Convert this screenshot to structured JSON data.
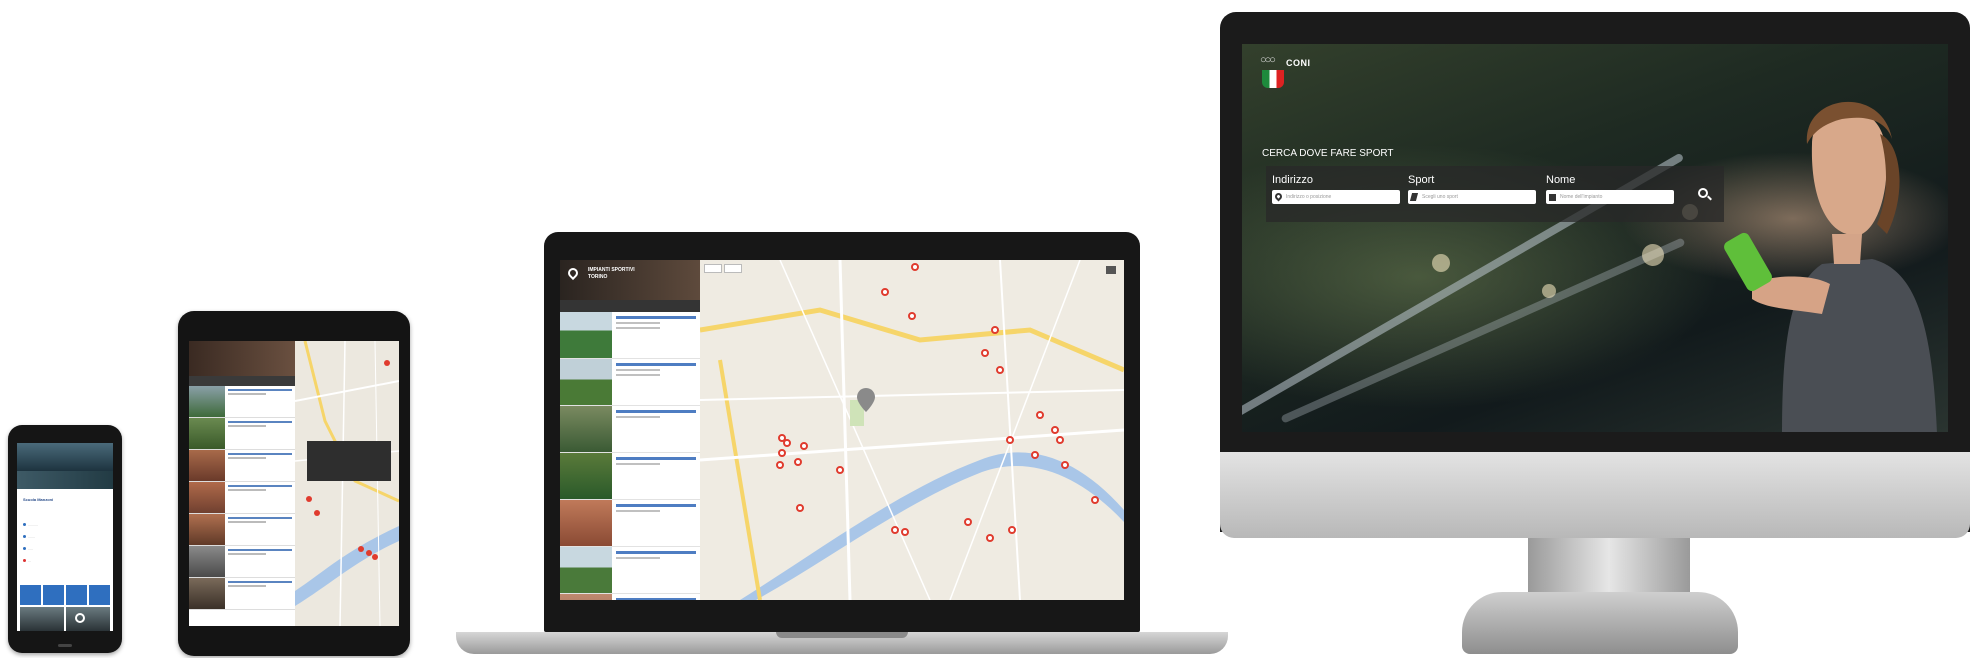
{
  "desktop": {
    "brand": {
      "name": "CONI",
      "rings_icon": "olympic-rings-icon",
      "flag_icon": "italy-flag-shield-icon"
    },
    "search": {
      "heading": "CERCA DOVE FARE SPORT",
      "fields": [
        {
          "label": "Indirizzo",
          "placeholder": "Indirizzo o posizione",
          "icon": "map-pin-icon"
        },
        {
          "label": "Sport",
          "placeholder": "Scegli uno sport",
          "icon": "runner-icon"
        },
        {
          "label": "Nome",
          "placeholder": "Nome dell'impianto",
          "icon": "building-icon"
        }
      ],
      "submit_icon": "search-icon"
    },
    "colors": {
      "panel": "#282828",
      "accent": "#ffffff"
    }
  },
  "laptop": {
    "header": {
      "title": "IMPIANTI SPORTIVI",
      "subtitle": "TORINO"
    },
    "map_pin_color": "#e03b2e",
    "list_item_count": 7
  },
  "tablet": {
    "map_pin_color": "#e03b2e",
    "list_item_count": 7
  },
  "phone": {
    "title": "Scuola Manzoni"
  }
}
